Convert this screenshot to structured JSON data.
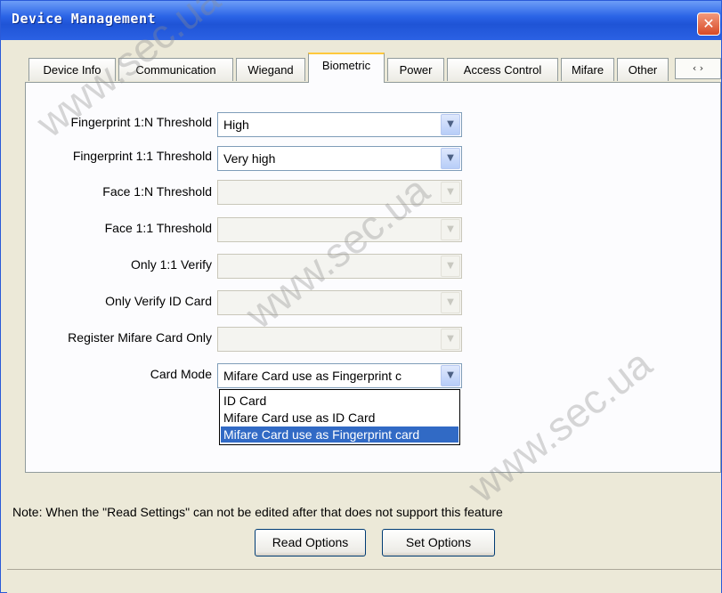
{
  "window": {
    "title": "Device Management",
    "close_glyph": "✕"
  },
  "tabs": [
    {
      "label": "Device Info"
    },
    {
      "label": "Communication"
    },
    {
      "label": "Wiegand"
    },
    {
      "label": "Biometric",
      "active": true
    },
    {
      "label": "Power"
    },
    {
      "label": "Access Control"
    },
    {
      "label": "Mifare"
    },
    {
      "label": "Other"
    }
  ],
  "tab_scroll_arrows": "‹ ›",
  "fields": [
    {
      "label": "Fingerprint 1:N Threshold",
      "value": "High",
      "enabled": true
    },
    {
      "label": "Fingerprint 1:1 Threshold",
      "value": "Very high",
      "enabled": true
    },
    {
      "label": "Face 1:N Threshold",
      "value": "",
      "enabled": false
    },
    {
      "label": "Face 1:1 Threshold",
      "value": "",
      "enabled": false
    },
    {
      "label": "Only 1:1 Verify",
      "value": "",
      "enabled": false
    },
    {
      "label": "Only Verify ID Card",
      "value": "",
      "enabled": false
    },
    {
      "label": "Register Mifare Card Only",
      "value": "",
      "enabled": false
    },
    {
      "label": "Card Mode",
      "value": "Mifare Card use as Fingerprint c",
      "enabled": true,
      "open": true
    }
  ],
  "card_mode_options": [
    {
      "label": "ID Card",
      "selected": false
    },
    {
      "label": "Mifare Card use as ID Card",
      "selected": false
    },
    {
      "label": "Mifare Card use as Fingerprint card",
      "selected": true
    }
  ],
  "note": "Note: When the \"Read Settings\" can not be edited after that does not support this feature",
  "buttons": {
    "read": "Read Options",
    "set": "Set Options"
  },
  "watermark": "www.sec.ua",
  "colors": {
    "title_bar": "#2a63e6",
    "selection": "#316ac5",
    "active_tab_accent": "#ffc83c",
    "close_button": "#d84a26"
  }
}
